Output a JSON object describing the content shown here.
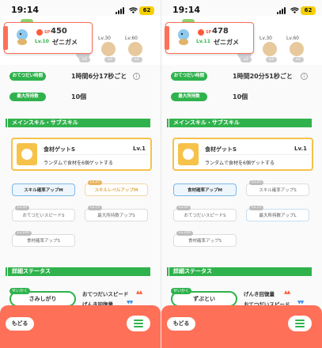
{
  "statusbar": {
    "time": "19:14",
    "battery": "62"
  },
  "panels": [
    {
      "sp_label": "SP",
      "sp_value": "450",
      "level": "Lv.10",
      "name": "ゼニガメ",
      "level_a": "Lv.30",
      "level_b": "Lv.60",
      "x_a": "x2",
      "x_b": "x2",
      "x_c": "x2",
      "help_label": "おてつだい時間",
      "help_value": "1時間6分17秒ごと",
      "carry_label": "最大所持数",
      "carry_value": "10個",
      "section_skills": "メインスキル・サブスキル",
      "main_skill": {
        "name": "食材ゲットS",
        "level": "Lv.1",
        "desc": "ランダムで食材を6個ゲットする"
      },
      "subs": [
        {
          "label": "スキル確率アップM",
          "lv": ""
        },
        {
          "label": "スキルレベルアップM",
          "lv": "Lv.25"
        },
        {
          "label": "おてつだいスピードS",
          "lv": "Lv.50"
        },
        {
          "label": "最大所持数アップS",
          "lv": "Lv.75"
        },
        {
          "label": "食材確率アップS",
          "lv": "Lv.100"
        }
      ],
      "section_status": "詳細ステータス",
      "nature_badge": "せいかく",
      "nature": "さみしがり",
      "up_label": "おてつだいスピード",
      "down_label": "げんき回復量",
      "back": "もどる"
    },
    {
      "sp_label": "SP",
      "sp_value": "478",
      "level": "Lv.11",
      "name": "ゼニガメ",
      "level_a": "Lv.30",
      "level_b": "Lv.60",
      "x_a": "x2",
      "x_b": "x2",
      "x_c": "x2",
      "help_label": "おてつだい時間",
      "help_value": "1時間20分51秒ごと",
      "carry_label": "最大所持数",
      "carry_value": "10個",
      "section_skills": "メインスキル・サブスキル",
      "main_skill": {
        "name": "食材ゲットS",
        "level": "Lv.1",
        "desc": "ランダムで食材を6個ゲットする"
      },
      "subs": [
        {
          "label": "食材確率アップM",
          "lv": ""
        },
        {
          "label": "スキル確率アップS",
          "lv": "Lv.25"
        },
        {
          "label": "おてつだいスピードS",
          "lv": "Lv.50"
        },
        {
          "label": "最大所持数アップL",
          "lv": "Lv.75"
        },
        {
          "label": "食材確率アップS",
          "lv": "Lv.100"
        }
      ],
      "section_status": "詳細ステータス",
      "nature_badge": "せいかく",
      "nature": "ずぶとい",
      "up_label": "げんき回復量",
      "down_label": "おてつだいスピード",
      "back": "もどる"
    }
  ],
  "colors": {
    "accent": "#ff7058",
    "green": "#2fb24c",
    "gold": "#f6c24a",
    "up": "#ff5a3c",
    "down": "#3d8fe6"
  }
}
